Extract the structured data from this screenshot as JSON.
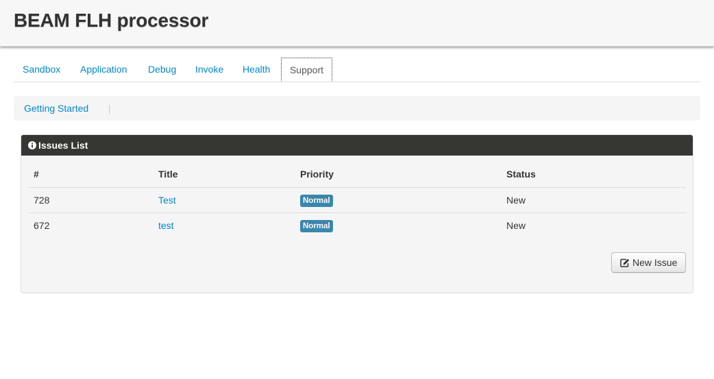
{
  "app": {
    "title": "BEAM FLH processor"
  },
  "tabs": [
    {
      "label": "Sandbox",
      "active": false
    },
    {
      "label": "Application",
      "active": false
    },
    {
      "label": "Debug",
      "active": false
    },
    {
      "label": "Invoke",
      "active": false
    },
    {
      "label": "Health",
      "active": false
    },
    {
      "label": "Support",
      "active": true
    }
  ],
  "subnav": {
    "items": [
      {
        "label": "Getting Started"
      }
    ],
    "separator": "|"
  },
  "issues_panel": {
    "title": "Issues List",
    "icon": "info-circle-icon",
    "columns": {
      "number": "#",
      "title": "Title",
      "priority": "Priority",
      "status": "Status"
    },
    "rows": [
      {
        "number": "728",
        "title": "Test",
        "priority": "Normal",
        "status": "New"
      },
      {
        "number": "672",
        "title": "test",
        "priority": "Normal",
        "status": "New"
      }
    ],
    "new_issue_button": {
      "label": "New Issue",
      "icon": "edit-icon"
    }
  },
  "colors": {
    "link": "#0088cc",
    "panel_header": "#363734",
    "badge_info": "#3a87ad"
  }
}
